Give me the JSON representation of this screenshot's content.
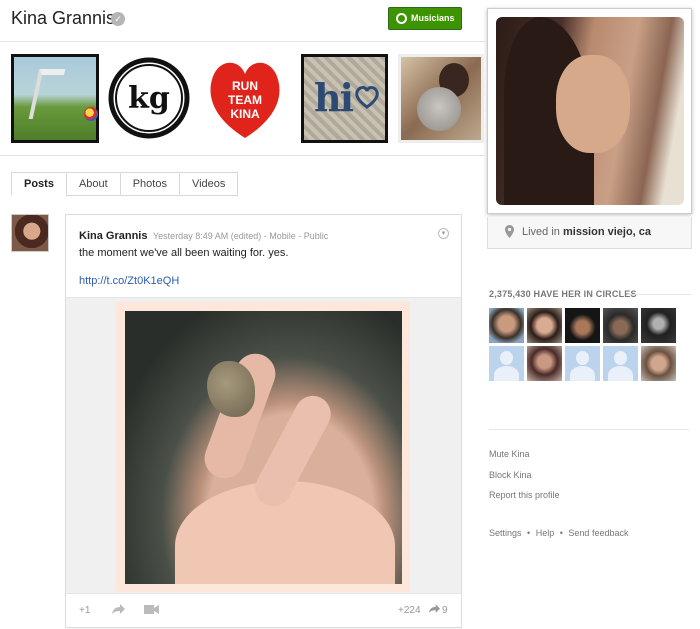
{
  "profile": {
    "name": "Kina Grannis",
    "circle_button": "Musicians",
    "location_prefix": "Lived in",
    "location": "mission viejo, ca"
  },
  "tabs": [
    "Posts",
    "About",
    "Photos",
    "Videos"
  ],
  "scrapbook": {
    "tile2_text": "kg",
    "tile3_text": "RUN TEAM KINA",
    "tile4_text": "hi"
  },
  "post": {
    "author": "Kina Grannis",
    "time": "Yesterday 8:49 AM (edited)",
    "source": "Mobile",
    "visibility": "Public",
    "text": "the moment we've all been waiting for. yes.",
    "link": "http://t.co/Zt0K1eQH",
    "plus_one": "+1",
    "plus_count": "+224",
    "share_count": "9"
  },
  "circles": {
    "title": "2,375,430 HAVE HER IN CIRCLES"
  },
  "right_links": {
    "mute": "Mute Kina",
    "block": "Block Kina",
    "report": "Report this profile"
  },
  "footer": {
    "settings": "Settings",
    "help": "Help",
    "feedback": "Send feedback"
  },
  "colors": {
    "green_button": "#3d9400",
    "link": "#2a5db0"
  }
}
